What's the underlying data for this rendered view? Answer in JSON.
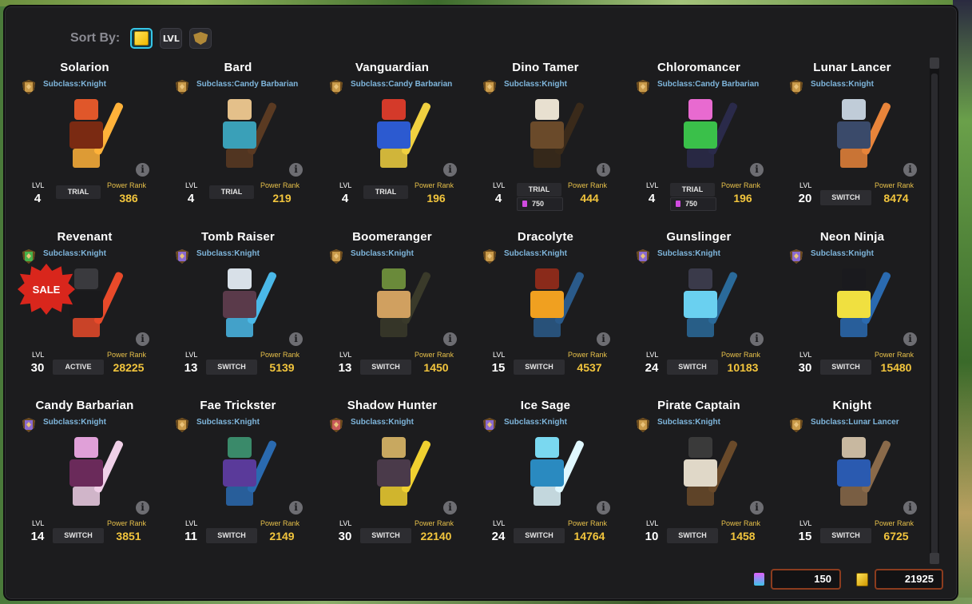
{
  "sort": {
    "label": "Sort By:",
    "buttons": [
      {
        "name": "power-cube",
        "label": "",
        "active": true
      },
      {
        "name": "lvl",
        "label": "LVL",
        "active": false
      },
      {
        "name": "rank",
        "label": "",
        "active": false
      }
    ]
  },
  "labels": {
    "lvl": "LVL",
    "power_rank": "Power Rank",
    "subclass_prefix": "Subclass:",
    "info": "i"
  },
  "classes": [
    {
      "name": "Solarion",
      "subclass": "Knight",
      "lvl": "4",
      "status": "TRIAL",
      "price": "",
      "power_rank": "386",
      "badge": "bronze",
      "colors": [
        "#e0572a",
        "#7a2a12",
        "#ffb23a"
      ]
    },
    {
      "name": "Bard",
      "subclass": "Candy Barbarian",
      "lvl": "4",
      "status": "TRIAL",
      "price": "",
      "power_rank": "219",
      "badge": "bronze",
      "colors": [
        "#e4c08a",
        "#3aa0b8",
        "#5a3a22"
      ]
    },
    {
      "name": "Vanguardian",
      "subclass": "Candy Barbarian",
      "lvl": "4",
      "status": "TRIAL",
      "price": "",
      "power_rank": "196",
      "badge": "bronze",
      "colors": [
        "#d43a2a",
        "#2c5ad0",
        "#f0d040"
      ]
    },
    {
      "name": "Dino Tamer",
      "subclass": "Knight",
      "lvl": "4",
      "status": "TRIAL",
      "price": "750",
      "power_rank": "444",
      "badge": "bronze",
      "colors": [
        "#e8e0d0",
        "#6a4a2a",
        "#3a2a1a"
      ]
    },
    {
      "name": "Chloromancer",
      "subclass": "Candy Barbarian",
      "lvl": "4",
      "status": "TRIAL",
      "price": "750",
      "power_rank": "196",
      "badge": "bronze",
      "colors": [
        "#e86ad0",
        "#3ac04a",
        "#2a2a4a"
      ]
    },
    {
      "name": "Lunar Lancer",
      "subclass": "Knight",
      "lvl": "20",
      "status": "SWITCH",
      "price": "",
      "power_rank": "8474",
      "badge": "bronze",
      "colors": [
        "#c0ccd8",
        "#3a4a6a",
        "#e8843a"
      ]
    },
    {
      "name": "Revenant",
      "subclass": "Knight",
      "lvl": "30",
      "status": "ACTIVE",
      "price": "",
      "power_rank": "28225",
      "badge": "green",
      "sale": "SALE",
      "colors": [
        "#3a3a3e",
        "#1a1a1c",
        "#e84a2a"
      ]
    },
    {
      "name": "Tomb Raiser",
      "subclass": "Knight",
      "lvl": "13",
      "status": "SWITCH",
      "price": "",
      "power_rank": "5139",
      "badge": "purple",
      "colors": [
        "#d8e0e8",
        "#5a3a4a",
        "#4ab8e8"
      ]
    },
    {
      "name": "Boomeranger",
      "subclass": "Knight",
      "lvl": "13",
      "status": "SWITCH",
      "price": "",
      "power_rank": "1450",
      "badge": "bronze",
      "colors": [
        "#6a8a3a",
        "#d0a060",
        "#3a3a2a"
      ]
    },
    {
      "name": "Dracolyte",
      "subclass": "Knight",
      "lvl": "15",
      "status": "SWITCH",
      "price": "",
      "power_rank": "4537",
      "badge": "bronze",
      "colors": [
        "#8a2a1a",
        "#f0a020",
        "#2a5a8a"
      ]
    },
    {
      "name": "Gunslinger",
      "subclass": "Knight",
      "lvl": "24",
      "status": "SWITCH",
      "price": "",
      "power_rank": "10183",
      "badge": "purple",
      "colors": [
        "#3a3a4a",
        "#6ad0f0",
        "#2a6a9a"
      ]
    },
    {
      "name": "Neon Ninja",
      "subclass": "Knight",
      "lvl": "30",
      "status": "SWITCH",
      "price": "",
      "power_rank": "15480",
      "badge": "purple",
      "colors": [
        "#1a1a1e",
        "#f0e040",
        "#2a6ab0"
      ]
    },
    {
      "name": "Candy Barbarian",
      "subclass": "Knight",
      "lvl": "14",
      "status": "SWITCH",
      "price": "",
      "power_rank": "3851",
      "badge": "purple",
      "colors": [
        "#e0a0d8",
        "#6a2a5a",
        "#f0d0e8"
      ]
    },
    {
      "name": "Fae Trickster",
      "subclass": "Knight",
      "lvl": "11",
      "status": "SWITCH",
      "price": "",
      "power_rank": "2149",
      "badge": "bronze",
      "colors": [
        "#3a8a6a",
        "#5a3a9a",
        "#2a6ab0"
      ]
    },
    {
      "name": "Shadow Hunter",
      "subclass": "Knight",
      "lvl": "30",
      "status": "SWITCH",
      "price": "",
      "power_rank": "22140",
      "badge": "red",
      "colors": [
        "#c8a860",
        "#4a3a4a",
        "#f0d030"
      ]
    },
    {
      "name": "Ice Sage",
      "subclass": "Knight",
      "lvl": "24",
      "status": "SWITCH",
      "price": "",
      "power_rank": "14764",
      "badge": "purple",
      "colors": [
        "#7ad8f0",
        "#2a8ac0",
        "#e0f8ff"
      ]
    },
    {
      "name": "Pirate Captain",
      "subclass": "Knight",
      "lvl": "10",
      "status": "SWITCH",
      "price": "",
      "power_rank": "1458",
      "badge": "bronze",
      "colors": [
        "#3a3a3a",
        "#e0d8c8",
        "#6a4a2a"
      ]
    },
    {
      "name": "Knight",
      "subclass": "Lunar Lancer",
      "lvl": "15",
      "status": "SWITCH",
      "price": "",
      "power_rank": "6725",
      "badge": "bronze",
      "colors": [
        "#c8b8a0",
        "#2a5ab0",
        "#8a6a4a"
      ]
    }
  ],
  "currency": {
    "flux": "150",
    "cubits": "21925"
  }
}
